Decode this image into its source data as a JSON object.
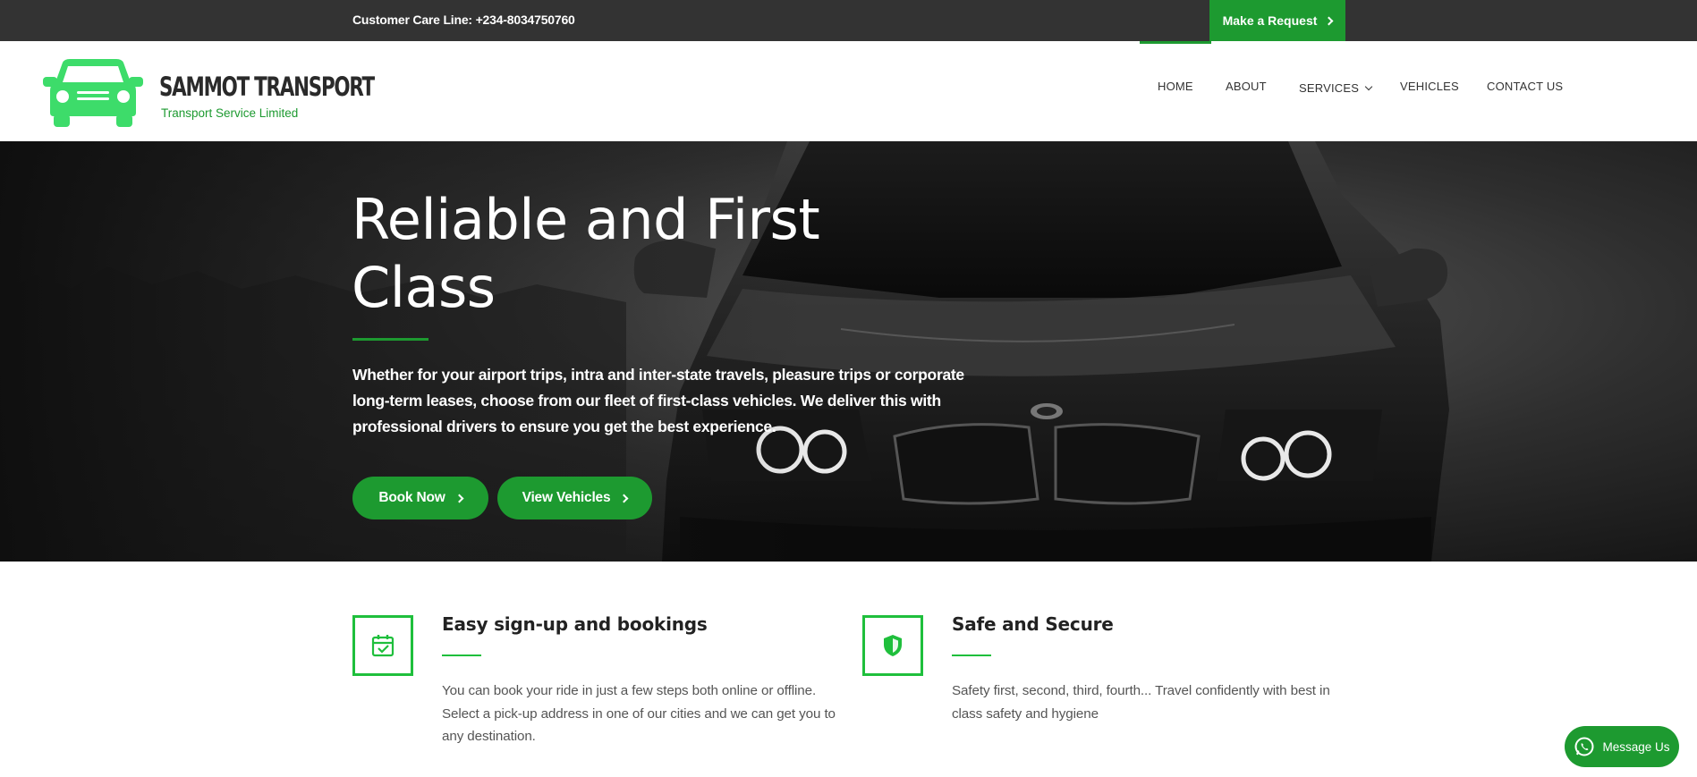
{
  "topbar": {
    "care_line": "Customer Care Line: +234-8034750760",
    "request_label": "Make a Request"
  },
  "brand": {
    "name": "SAMMOT TRANSPORT",
    "tagline": "Transport Service Limited",
    "color": "#3ddc6a"
  },
  "nav": {
    "items": [
      {
        "label": "HOME",
        "active": true
      },
      {
        "label": "ABOUT",
        "active": false
      },
      {
        "label": "SERVICES",
        "active": false,
        "has_dropdown": true
      },
      {
        "label": "VEHICLES",
        "active": false
      },
      {
        "label": "CONTACT US",
        "active": false
      }
    ]
  },
  "hero": {
    "title": "Reliable and First Class",
    "description": "Whether for your airport trips, intra and inter-state travels, pleasure trips or corporate long-term leases, choose from our fleet of first-class vehicles. We deliver this with professional drivers to ensure you get the best experience.",
    "book_label": "Book Now",
    "view_label": "View Vehicles"
  },
  "features": [
    {
      "icon": "calendar-check-icon",
      "title": "Easy sign-up and bookings",
      "text": "You can book your ride in just a few steps both online or offline. Select a pick-up address in one of our cities and we can get you to any destination."
    },
    {
      "icon": "shield-icon",
      "title": "Safe and Secure",
      "text": "Safety first, second, third, fourth... Travel confidently with best in class safety and hygiene"
    }
  ],
  "whatsapp": {
    "label": "Message Us"
  },
  "colors": {
    "accent": "#1d9a30",
    "accent_light": "#1fbf3c",
    "topbar": "#333333"
  }
}
